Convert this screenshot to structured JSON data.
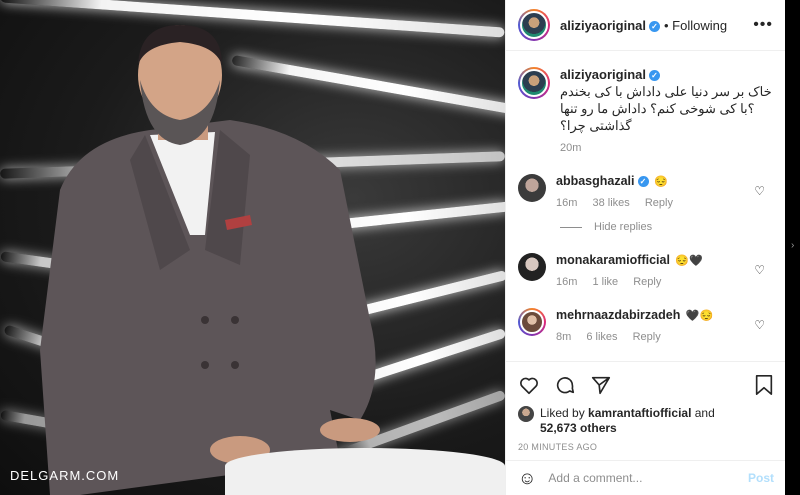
{
  "watermark": "DELGARM.COM",
  "header": {
    "username": "aliziyaoriginal",
    "separator": "•",
    "follow_status": "Following",
    "more": "•••"
  },
  "caption": {
    "username": "aliziyaoriginal",
    "text": "خاک بر سر دنیا علی داداش با کی بخندم ؟با کی شوخی کنم؟ داداش ما رو تنها گذاشتی چرا؟",
    "time": "20m"
  },
  "comments": [
    {
      "username": "abbasghazali",
      "emoji": "😔",
      "verified": true,
      "time": "16m",
      "likes": "38 likes",
      "reply": "Reply"
    },
    {
      "username": "monakaramiofficial",
      "emoji": "😔🖤",
      "verified": false,
      "time": "16m",
      "likes": "1 like",
      "reply": "Reply"
    },
    {
      "username": "mehrnaazdabirzadeh",
      "emoji": "🖤😔",
      "verified": false,
      "time": "8m",
      "likes": "6 likes",
      "reply": "Reply"
    }
  ],
  "hide_replies": "Hide replies",
  "likes": {
    "prefix": "Liked by",
    "user": "kamrantaftiofficial",
    "and": "and",
    "count": "52,673 others"
  },
  "posted_ago": "20 MINUTES AGO",
  "add_comment": {
    "placeholder": "Add a comment...",
    "post": "Post"
  },
  "colors": {
    "accent": "#3897f0",
    "muted": "#8e8e8e",
    "post_disabled": "#b2dffc"
  }
}
